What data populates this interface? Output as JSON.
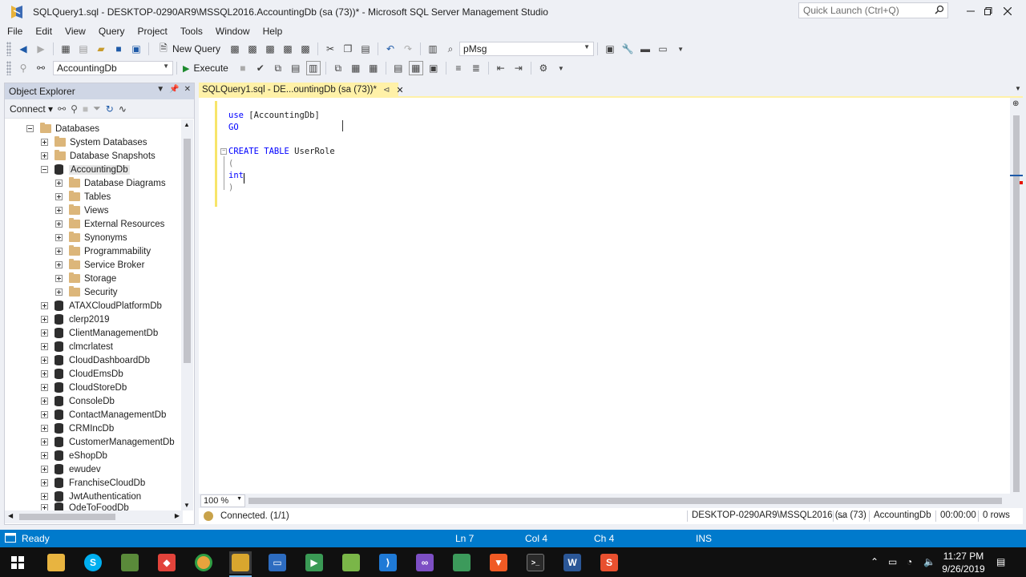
{
  "window": {
    "title": "SQLQuery1.sql - DESKTOP-0290AR9\\MSSQL2016.AccountingDb (sa (73))* - Microsoft SQL Server Management Studio",
    "quick_launch_placeholder": "Quick Launch (Ctrl+Q)"
  },
  "menu": [
    "File",
    "Edit",
    "View",
    "Query",
    "Project",
    "Tools",
    "Window",
    "Help"
  ],
  "toolbar1": {
    "new_query": "New Query",
    "find_combo": "pMsg"
  },
  "toolbar2": {
    "database_combo": "AccountingDb",
    "execute": "Execute"
  },
  "object_explorer": {
    "title": "Object Explorer",
    "connect": "Connect",
    "tree": [
      {
        "label": "Databases",
        "level": 1,
        "icon": "folder",
        "state": "expanded"
      },
      {
        "label": "System Databases",
        "level": 2,
        "icon": "folder",
        "state": "collapsed"
      },
      {
        "label": "Database Snapshots",
        "level": 2,
        "icon": "folder",
        "state": "collapsed"
      },
      {
        "label": "AccountingDb",
        "level": 2,
        "icon": "db",
        "state": "expanded",
        "selected": true
      },
      {
        "label": "Database Diagrams",
        "level": 3,
        "icon": "folder",
        "state": "collapsed"
      },
      {
        "label": "Tables",
        "level": 3,
        "icon": "folder",
        "state": "collapsed"
      },
      {
        "label": "Views",
        "level": 3,
        "icon": "folder",
        "state": "collapsed"
      },
      {
        "label": "External Resources",
        "level": 3,
        "icon": "folder",
        "state": "collapsed"
      },
      {
        "label": "Synonyms",
        "level": 3,
        "icon": "folder",
        "state": "collapsed"
      },
      {
        "label": "Programmability",
        "level": 3,
        "icon": "folder",
        "state": "collapsed"
      },
      {
        "label": "Service Broker",
        "level": 3,
        "icon": "folder",
        "state": "collapsed"
      },
      {
        "label": "Storage",
        "level": 3,
        "icon": "folder",
        "state": "collapsed"
      },
      {
        "label": "Security",
        "level": 3,
        "icon": "folder",
        "state": "collapsed"
      },
      {
        "label": "ATAXCloudPlatformDb",
        "level": 2,
        "icon": "db",
        "state": "collapsed"
      },
      {
        "label": "clerp2019",
        "level": 2,
        "icon": "db",
        "state": "collapsed"
      },
      {
        "label": "ClientManagementDb",
        "level": 2,
        "icon": "db",
        "state": "collapsed"
      },
      {
        "label": "clmcrlatest",
        "level": 2,
        "icon": "db",
        "state": "collapsed"
      },
      {
        "label": "CloudDashboardDb",
        "level": 2,
        "icon": "db",
        "state": "collapsed"
      },
      {
        "label": "CloudEmsDb",
        "level": 2,
        "icon": "db",
        "state": "collapsed"
      },
      {
        "label": "CloudStoreDb",
        "level": 2,
        "icon": "db",
        "state": "collapsed"
      },
      {
        "label": "ConsoleDb",
        "level": 2,
        "icon": "db",
        "state": "collapsed"
      },
      {
        "label": "ContactManagementDb",
        "level": 2,
        "icon": "db",
        "state": "collapsed"
      },
      {
        "label": "CRMIncDb",
        "level": 2,
        "icon": "db",
        "state": "collapsed"
      },
      {
        "label": "CustomerManagementDb",
        "level": 2,
        "icon": "db",
        "state": "collapsed"
      },
      {
        "label": "eShopDb",
        "level": 2,
        "icon": "db",
        "state": "collapsed"
      },
      {
        "label": "ewudev",
        "level": 2,
        "icon": "db",
        "state": "collapsed"
      },
      {
        "label": "FranchiseCloudDb",
        "level": 2,
        "icon": "db",
        "state": "collapsed"
      },
      {
        "label": "JwtAuthentication",
        "level": 2,
        "icon": "db",
        "state": "collapsed"
      },
      {
        "label": "OdeToFoodDb",
        "level": 2,
        "icon": "db",
        "state": "collapsed"
      }
    ]
  },
  "editor": {
    "tab_label": "SQLQuery1.sql - DE...ountingDb (sa (73))*",
    "code": {
      "l1_kw": "use",
      "l1_rest": " [AccountingDb]",
      "l2_kw": "GO",
      "l3_kw": "CREATE TABLE",
      "l3_rest": " UserRole",
      "l4": "(",
      "l5_kw": "int",
      "l6": ")"
    },
    "zoom": "100 %"
  },
  "query_status": {
    "connected": "Connected. (1/1)",
    "server": "DESKTOP-0290AR9\\MSSQL2016 (...",
    "user": "sa (73)",
    "database": "AccountingDb",
    "elapsed": "00:00:00",
    "rows": "0 rows"
  },
  "statusbar": {
    "ready": "Ready",
    "ln": "Ln 7",
    "col": "Col 4",
    "ch": "Ch 4",
    "ins": "INS"
  },
  "taskbar": {
    "time": "11:27 PM",
    "date": "9/26/2019"
  },
  "colors": {
    "accent_blue": "#007acc",
    "tab_yellow": "#fff1a8",
    "keyword_blue": "#0000ff"
  }
}
